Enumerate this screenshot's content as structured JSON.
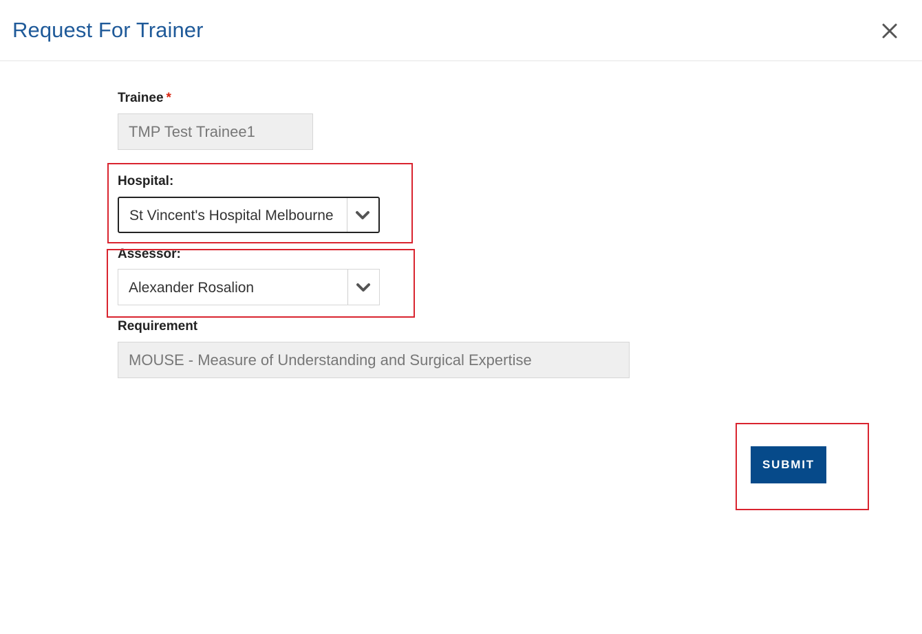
{
  "dialog": {
    "title": "Request For Trainer",
    "close_icon": "close-icon"
  },
  "form": {
    "trainee": {
      "label": "Trainee",
      "required_mark": "*",
      "value": "TMP Test Trainee1"
    },
    "hospital": {
      "label": "Hospital:",
      "selected": "St Vincent's Hospital Melbourne",
      "icon": "chevron-down-icon"
    },
    "assessor": {
      "label": "Assessor:",
      "selected": "Alexander Rosalion",
      "icon": "chevron-down-icon"
    },
    "requirement": {
      "label": "Requirement",
      "value": "MOUSE - Measure of Understanding and Surgical Expertise"
    }
  },
  "actions": {
    "submit_label": "SUBMIT"
  },
  "colors": {
    "title": "#1f5a99",
    "submit_button": "#064a8a",
    "required": "#d9230f",
    "annotation": "#d9232e"
  }
}
